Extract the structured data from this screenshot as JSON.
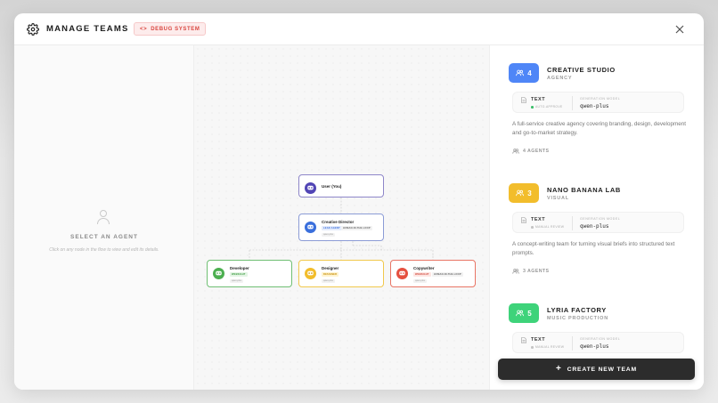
{
  "header": {
    "title": "MANAGE TEAMS",
    "debug_label": "DEBUG SYSTEM"
  },
  "empty_state": {
    "title": "SELECT AN AGENT",
    "subtitle": "Click on any node in the flow to view and edit its details."
  },
  "flow": {
    "user_node": {
      "name": "User (You)"
    },
    "director_node": {
      "name": "Creative Director",
      "tags": [
        "LEAD AGENT",
        "HUMAN-IN-THE-LOOP"
      ],
      "model": "qwen-plus"
    },
    "children": [
      {
        "name": "Developer",
        "tag": "WEBSIGHT",
        "model": "qwen-plus",
        "color": "#4caf50"
      },
      {
        "name": "Designer",
        "tag": "DESIGNER",
        "model": "qwen-plus",
        "color": "#f2bd2c"
      },
      {
        "name": "Copywriter",
        "tags": [
          "WEBSIGHT",
          "HUMAN-IN-THE-LOOP"
        ],
        "model": "qwen-plus",
        "color": "#e5503f"
      }
    ]
  },
  "teams": [
    {
      "count": "4",
      "name": "CREATIVE STUDIO",
      "category": "AGENCY",
      "color": "#4f86f7",
      "mode_type": "TEXT",
      "mode": "AUTO-APPROVE",
      "mode_color": "#3bbf6a",
      "gen_label": "GENERATION MODEL",
      "model": "qwen-plus",
      "description": "A full-service creative agency covering branding, design, development and go-to-market strategy.",
      "agents": "4 AGENTS"
    },
    {
      "count": "3",
      "name": "NANO BANANA LAB",
      "category": "VISUAL",
      "color": "#f2bd2c",
      "mode_type": "TEXT",
      "mode": "MANUAL REVIEW",
      "mode_color": "#c4c4c4",
      "gen_label": "GENERATION MODEL",
      "model": "qwen-plus",
      "description": "A concept-writing team for turning visual briefs into structured text prompts.",
      "agents": "3 AGENTS"
    },
    {
      "count": "5",
      "name": "LYRIA FACTORY",
      "category": "MUSIC PRODUCTION",
      "color": "#3ed37a",
      "mode_type": "TEXT",
      "mode": "MANUAL REVIEW",
      "mode_color": "#c4c4c4",
      "gen_label": "GENERATION MODEL",
      "model": "qwen-plus",
      "description": "",
      "agents": ""
    }
  ],
  "create_button": {
    "label": "CREATE NEW TEAM"
  }
}
